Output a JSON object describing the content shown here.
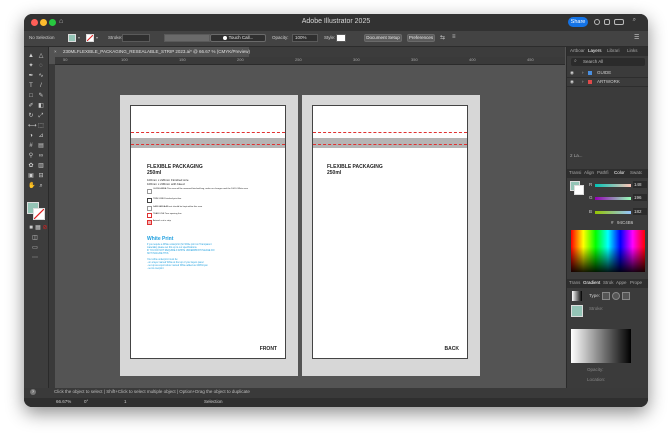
{
  "app": {
    "title": "Adobe Illustrator 2025",
    "share_label": "Share"
  },
  "control_bar": {
    "selection": "No Selection",
    "stroke_label": "Stroke:",
    "brush": "Touch Call...",
    "opacity_label": "Opacity:",
    "opacity_value": "100%",
    "style_label": "Style:",
    "document_setup": "Document Setup",
    "preferences": "Preferences"
  },
  "document_tab": "230MLFLEXIBLE_PACKAGING_RESEALABLE_STRIP 2023.ai* @ 66.67 % (CMYK/Preview)",
  "ruler": {
    "marks": [
      "50",
      "100",
      "150",
      "200",
      "250",
      "300",
      "350",
      "400",
      "450"
    ]
  },
  "artboards": {
    "front": {
      "heading": "FLEXIBLE PACKAGING",
      "volume": "250ml",
      "size_line1": "100mm x 220mm Finished size",
      "size_line2": "106mm x 230mm with bleed",
      "legend": [
        "GUIDE AREA This area will be removed finished bag, make no changes and the 100% White area",
        "TRIM LINE Finished print bar",
        "SAFE AREA All text should be kept within this area",
        "TEAR LINE Tear opening line",
        "Artwork cut in strip"
      ],
      "white_print_title": "White Print",
      "white_print_lines": [
        "If you require a White underprint (for White print on Transparent",
        "materials) please set this up to our specifications.",
        "IF YOU DO NOT REQUIRE A WHITE UNDERPRINT PLEASE DO",
        "NOT INCLUDE THIS",
        "Your white underprint must be:",
        "- on a layer named White at the top of your layers panel",
        "- set up as a spot colour named White added as 100%Cyan",
        "- set to overprint"
      ],
      "label": "FRONT"
    },
    "back": {
      "heading": "FLEXIBLE PACKAGING",
      "volume": "250ml",
      "label": "BACK"
    }
  },
  "status": {
    "hint": "Click the object to select  |  Shift+Click to select multiple object  |  Option+Drag the object to duplicate",
    "zoom": "66.67%",
    "rotation": "0°",
    "page": "1",
    "mode": "Selection"
  },
  "panels": {
    "top_tabs": [
      "Artboar",
      "Layers",
      "Librari",
      "Links"
    ],
    "search_placeholder": "Search All",
    "layers": [
      {
        "name": "GUIDE",
        "color": "#4a8fe0"
      },
      {
        "name": "ARTWORK",
        "color": "#e04a4a"
      }
    ],
    "layers_count": "2 La...",
    "color_tabs": [
      "Transi",
      "Align",
      "Pathfi",
      "Color",
      "Swatc"
    ],
    "color_channels": [
      {
        "label": "R",
        "value": "148"
      },
      {
        "label": "G",
        "value": "196"
      },
      {
        "label": "B",
        "value": "182"
      }
    ],
    "hex": "94C4B6",
    "gradient_tabs": [
      "Trans",
      "Gradient",
      "Strok",
      "Appe",
      "Prope"
    ],
    "gradient_type_label": "Type:",
    "gradient_stroke_label": "Stroke:",
    "opacity_label": "Opacity:",
    "location_label": "Location:"
  },
  "colors": {
    "fill": "#94c4b6",
    "accent": "#1473e6",
    "guide_line": "#e03030",
    "strip": "#b5b4b4"
  }
}
